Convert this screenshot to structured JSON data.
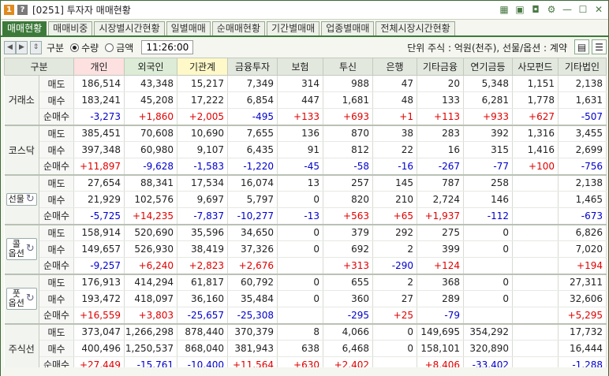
{
  "titlebar": {
    "code": "[0251]",
    "title": "투자자 매매현황",
    "badge1": "1",
    "badge2": "?"
  },
  "tabs": [
    "매매현황",
    "매매비중",
    "시장별시간현황",
    "일별매매",
    "순매매현황",
    "기간별매매",
    "업종별매매",
    "전체시장시간현황"
  ],
  "toolbar": {
    "label_gubun": "구분",
    "radio_qty": "수량",
    "radio_amt": "금액",
    "time": "11:26:00",
    "unit_text": "단위 주식 : 억원(천주), 선물/옵션 : 계약"
  },
  "columns": [
    "구분",
    "개인",
    "외국인",
    "기관계",
    "금융투자",
    "보험",
    "투신",
    "은행",
    "기타금융",
    "연기금등",
    "사모펀드",
    "기타법인"
  ],
  "row_labels": [
    "매도",
    "매수",
    "순매수"
  ],
  "groups": [
    {
      "name": "거래소",
      "button": false,
      "rows": [
        [
          "186,514",
          "43,348",
          "15,217",
          "7,349",
          "314",
          "988",
          "47",
          "20",
          "5,348",
          "1,151",
          "2,138"
        ],
        [
          "183,241",
          "45,208",
          "17,222",
          "6,854",
          "447",
          "1,681",
          "48",
          "133",
          "6,281",
          "1,778",
          "1,631"
        ],
        [
          "-3,273",
          "+1,860",
          "+2,005",
          "-495",
          "+133",
          "+693",
          "+1",
          "+113",
          "+933",
          "+627",
          "-507"
        ]
      ]
    },
    {
      "name": "코스닥",
      "button": false,
      "rows": [
        [
          "385,451",
          "70,608",
          "10,690",
          "7,655",
          "136",
          "870",
          "38",
          "283",
          "392",
          "1,316",
          "3,455"
        ],
        [
          "397,348",
          "60,980",
          "9,107",
          "6,435",
          "91",
          "812",
          "22",
          "16",
          "315",
          "1,416",
          "2,699"
        ],
        [
          "+11,897",
          "-9,628",
          "-1,583",
          "-1,220",
          "-45",
          "-58",
          "-16",
          "-267",
          "-77",
          "+100",
          "-756"
        ]
      ]
    },
    {
      "name": "선물",
      "button": true,
      "rows": [
        [
          "27,654",
          "88,341",
          "17,534",
          "16,074",
          "13",
          "257",
          "145",
          "787",
          "258",
          "",
          "2,138"
        ],
        [
          "21,929",
          "102,576",
          "9,697",
          "5,797",
          "0",
          "820",
          "210",
          "2,724",
          "146",
          "",
          "1,465"
        ],
        [
          "-5,725",
          "+14,235",
          "-7,837",
          "-10,277",
          "-13",
          "+563",
          "+65",
          "+1,937",
          "-112",
          "",
          "-673"
        ]
      ]
    },
    {
      "name": "콜옵션",
      "name_lines": [
        "콜",
        "옵션"
      ],
      "button": true,
      "rows": [
        [
          "158,914",
          "520,690",
          "35,596",
          "34,650",
          "0",
          "379",
          "292",
          "275",
          "0",
          "",
          "6,826"
        ],
        [
          "149,657",
          "526,930",
          "38,419",
          "37,326",
          "0",
          "692",
          "2",
          "399",
          "0",
          "",
          "7,020"
        ],
        [
          "-9,257",
          "+6,240",
          "+2,823",
          "+2,676",
          "",
          "+313",
          "-290",
          "+124",
          "",
          "",
          "+194"
        ]
      ]
    },
    {
      "name": "풋옵션",
      "name_lines": [
        "풋",
        "옵션"
      ],
      "button": true,
      "rows": [
        [
          "176,913",
          "414,294",
          "61,817",
          "60,792",
          "0",
          "655",
          "2",
          "368",
          "0",
          "",
          "27,311"
        ],
        [
          "193,472",
          "418,097",
          "36,160",
          "35,484",
          "0",
          "360",
          "27",
          "289",
          "0",
          "",
          "32,606"
        ],
        [
          "+16,559",
          "+3,803",
          "-25,657",
          "-25,308",
          "",
          "-295",
          "+25",
          "-79",
          "",
          "",
          "+5,295"
        ]
      ]
    },
    {
      "name": "주식선",
      "button": false,
      "rows": [
        [
          "373,047",
          "1,266,298",
          "878,440",
          "370,379",
          "8",
          "4,066",
          "0",
          "149,695",
          "354,292",
          "",
          "17,732"
        ],
        [
          "400,496",
          "1,250,537",
          "868,040",
          "381,943",
          "638",
          "6,468",
          "0",
          "158,101",
          "320,890",
          "",
          "16,444"
        ],
        [
          "+27,449",
          "-15,761",
          "-10,400",
          "+11,564",
          "+630",
          "+2,402",
          "",
          "+8,406",
          "-33,402",
          "",
          "-1,288"
        ]
      ]
    }
  ],
  "colors": {
    "accent": "#3d7a3a",
    "positive": "#e00000",
    "negative": "#0000cc"
  },
  "icons": [
    "layout-icon",
    "save-icon",
    "camera-icon",
    "settings-icon",
    "minimize-icon",
    "maximize-icon",
    "close-icon",
    "refresh-icon",
    "sheet-icon",
    "menu-icon"
  ]
}
